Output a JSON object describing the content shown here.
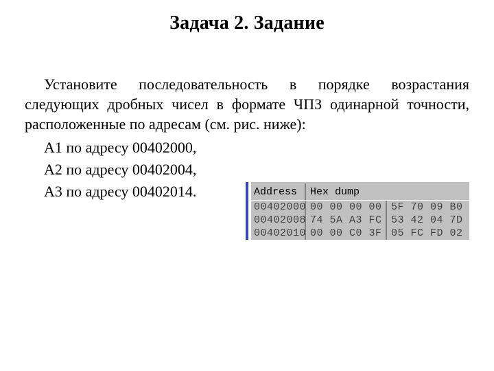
{
  "title": "Задача 2. Задание",
  "paragraph": "Установите последовательность в порядке возрастания следующих дробных чисел в формате ЧПЗ одинарной точности, расположенные по адресам (см. рис. ниже):",
  "addresses": [
    "А1 по адресу 00402000,",
    "А2 по адресу 00402004,",
    "А3 по адресу 00402014."
  ],
  "hex": {
    "header_addr": "Address",
    "header_hex": "Hex dump",
    "rows": [
      {
        "addr": "00402000",
        "g1": "00 00 00 00",
        "g2": "5F 70 09 B0"
      },
      {
        "addr": "00402008",
        "g1": "74 5A A3 FC",
        "g2": "53 42 04 7D"
      },
      {
        "addr": "00402010",
        "g1": "00 00 C0 3F",
        "g2": "05 FC FD 02"
      }
    ]
  }
}
